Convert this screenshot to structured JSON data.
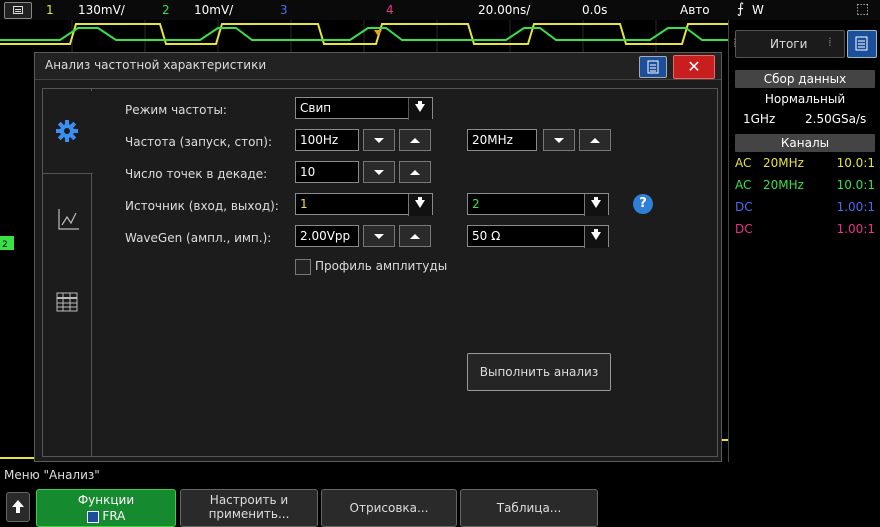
{
  "topbar": {
    "ch1_num": "1",
    "ch1_scale": "130mV/",
    "ch2_num": "2",
    "ch2_scale": "10mV/",
    "ch3_num": "3",
    "ch4_num": "4",
    "timebase": "20.00ns/",
    "delay": "0.0s",
    "trigger_mode": "Авто",
    "trigger_source": "W"
  },
  "right_panel": {
    "tab_label": "Итоги",
    "acq_header": "Сбор данных",
    "acq_mode": "Нормальный",
    "bandwidth": "1GHz",
    "sample_rate": "2.50GSa/s",
    "channels_header": "Каналы",
    "channels": [
      {
        "coupling": "AC",
        "bw": "20MHz",
        "probe": "10.0:1",
        "color": "#e8e43a"
      },
      {
        "coupling": "AC",
        "bw": "20MHz",
        "probe": "10.0:1",
        "color": "#39e046"
      },
      {
        "coupling": "DC",
        "bw": "",
        "probe": "1.00:1",
        "color": "#4a6cf0"
      },
      {
        "coupling": "DC",
        "bw": "",
        "probe": "1.00:1",
        "color": "#e8348a"
      }
    ]
  },
  "dialog": {
    "title": "Анализ частотной характеристики",
    "freq_mode_label": "Режим частоты:",
    "freq_mode_value": "Свип",
    "freq_label": "Частота (запуск, стоп):",
    "freq_start": "100Hz",
    "freq_stop": "20MHz",
    "points_label": "Число точек в декаде:",
    "points_value": "10",
    "source_label": "Источник (вход, выход):",
    "source_in": "1",
    "source_out": "2",
    "wavegen_label": "WaveGen (ампл., имп.):",
    "wavegen_amp": "2.00Vpp",
    "wavegen_imp": "50 Ω",
    "amp_profile_label": "Профиль амплитуды",
    "run_button": "Выполнить анализ"
  },
  "bottom": {
    "menu_title": "Меню \"Анализ\"",
    "functions_label": "Функции",
    "fra_label": "FRA",
    "setup_label_1": "Настроить и",
    "setup_label_2": "применить...",
    "plot_label": "Отрисовка...",
    "table_label": "Таблица..."
  },
  "colors": {
    "ch1": "#e8e43a",
    "ch2": "#39e046",
    "ch3": "#4a6cf0",
    "ch4": "#e8348a",
    "accent_blue": "#1b4f9c",
    "close_red": "#c81e1e",
    "softkey_green": "#168a2e"
  }
}
